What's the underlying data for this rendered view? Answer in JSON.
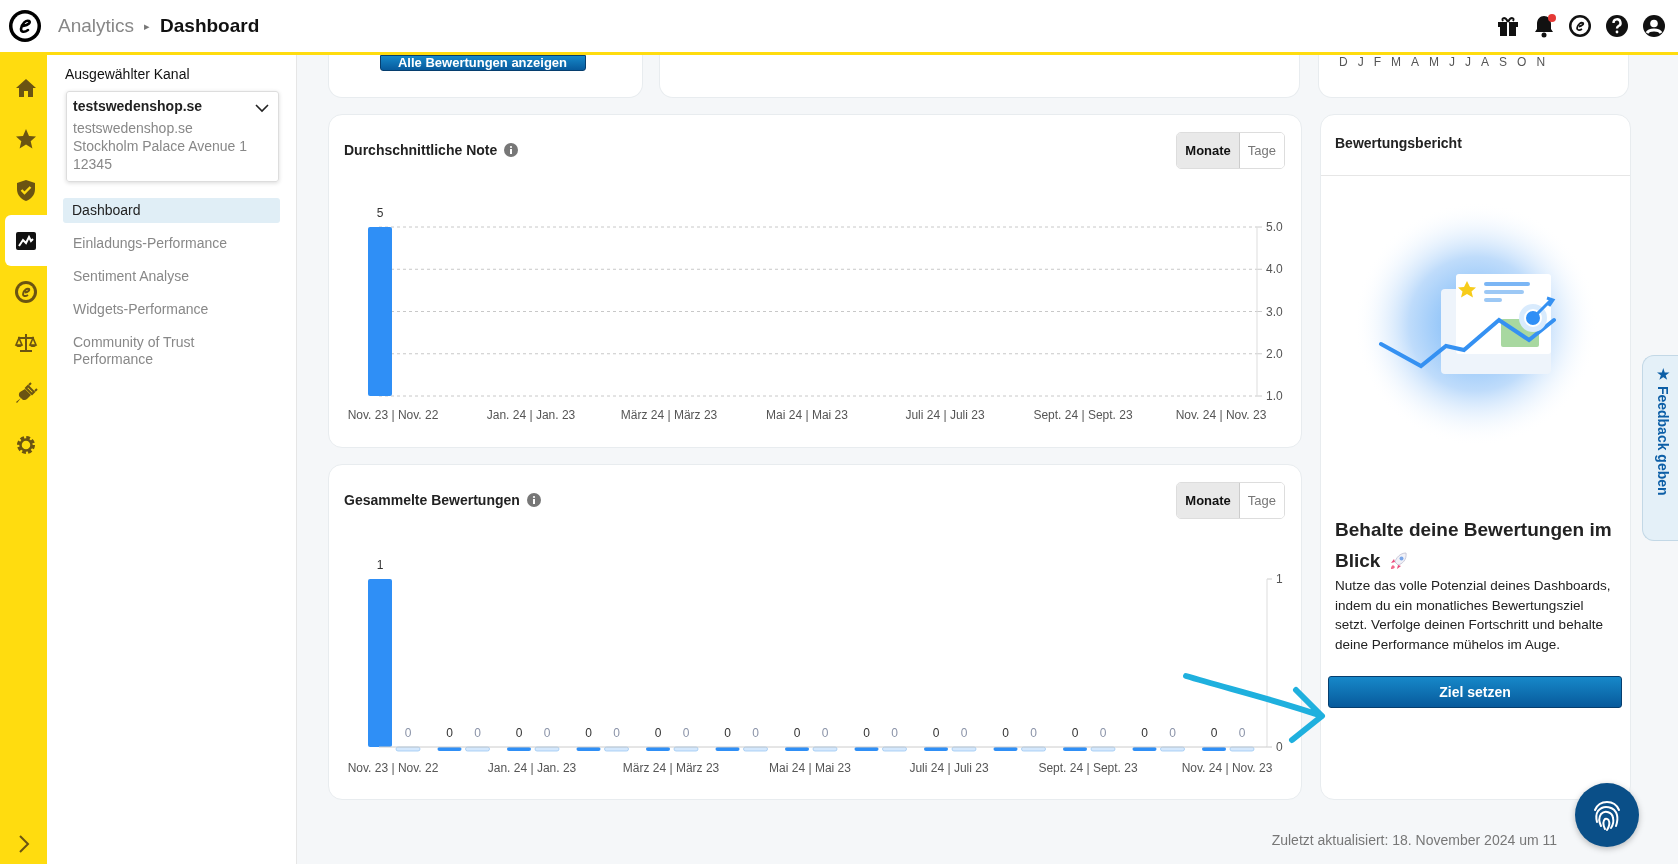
{
  "header": {
    "breadcrumb": [
      "Analytics",
      "Dashboard"
    ],
    "separator": "▸",
    "bell_notification": true
  },
  "rail": {
    "items": [
      {
        "selected": false
      },
      {
        "selected": false
      },
      {
        "selected": false
      },
      {
        "selected": true
      },
      {
        "selected": false
      },
      {
        "selected": false
      },
      {
        "selected": false
      },
      {
        "selected": false
      }
    ]
  },
  "sidebar": {
    "label": "Ausgewählter Kanal",
    "channel": {
      "name": "testswedenshop.se",
      "lines": [
        "testswedenshop.se",
        "Stockholm Palace Avenue 1",
        "12345"
      ]
    },
    "items": [
      {
        "label": "Dashboard",
        "selected": true
      },
      {
        "label": "Einladungs-Performance",
        "selected": false
      },
      {
        "label": "Sentiment Analyse",
        "selected": false
      },
      {
        "label": "Widgets-Performance",
        "selected": false
      },
      {
        "label": "Community of Trust Performance",
        "selected": false
      }
    ]
  },
  "top_cards": {
    "button": "Alle Bewertungen anzeigen",
    "month_letters": [
      "D",
      "J",
      "F",
      "M",
      "A",
      "M",
      "J",
      "J",
      "A",
      "S",
      "O",
      "N"
    ]
  },
  "charts": [
    {
      "title": "Durchschnittliche Note",
      "toggle": [
        {
          "label": "Monate",
          "selected": true
        },
        {
          "label": "Tage",
          "selected": false
        }
      ],
      "chart_data": {
        "type": "bar",
        "categories": [
          "Nov. 23 | Nov. 22",
          null,
          "Jan. 24 | Jan. 23",
          null,
          "März 24 | März 23",
          null,
          "Mai 24 | Mai 23",
          null,
          "Juli 24 | Juli 23",
          null,
          "Sept. 24 | Sept. 23",
          null,
          "Nov. 24 | Nov. 23"
        ],
        "series": [
          {
            "color": "#2f8ff6",
            "values": [
              5,
              null,
              null,
              null,
              null,
              null,
              null,
              null,
              null,
              null,
              null,
              null,
              null
            ]
          }
        ],
        "ylim": [
          1,
          5
        ],
        "yticks": [
          {
            "value": 1,
            "label": "1.0"
          },
          {
            "value": 2,
            "label": "2.0"
          },
          {
            "value": 3,
            "label": "3.0"
          },
          {
            "value": 4,
            "label": "4.0"
          },
          {
            "value": 5,
            "label": "5.0"
          }
        ],
        "grid": true,
        "data_labels": true
      }
    },
    {
      "title": "Gesammelte Bewertungen",
      "toggle": [
        {
          "label": "Monate",
          "selected": true
        },
        {
          "label": "Tage",
          "selected": false
        }
      ],
      "chart_data": {
        "type": "bar",
        "categories": [
          "Nov. 23 | Nov. 22",
          null,
          "Jan. 24 | Jan. 23",
          null,
          "März 24 | März 23",
          null,
          "Mai 24 | Mai 23",
          null,
          "Juli 24 | Juli 23",
          null,
          "Sept. 24 | Sept. 23",
          null,
          "Nov. 24 | Nov. 23"
        ],
        "series": [
          {
            "color": "#2f8ff6",
            "values": [
              1,
              0,
              0,
              0,
              0,
              0,
              0,
              0,
              0,
              0,
              0,
              0,
              0
            ]
          },
          {
            "color": "#d4e8fd",
            "values": [
              0,
              0,
              0,
              0,
              0,
              0,
              0,
              0,
              0,
              0,
              0,
              0,
              0
            ]
          }
        ],
        "ylim": [
          0,
          1
        ],
        "yticks": [
          {
            "value": 0,
            "label": "0"
          },
          {
            "value": 1,
            "label": "1"
          }
        ],
        "data_labels": true
      }
    }
  ],
  "report": {
    "title": "Bewertungsbericht",
    "heading_lines": [
      "Behalte deine Bewertungen im",
      "Blick"
    ],
    "text": "Nutze das volle Potenzial deines Dashboards, indem du ein monatliches Bewertungsziel setzt. Verfolge deinen Fortschritt und behalte deine Performance mühelos im Auge.",
    "button": "Ziel setzen"
  },
  "feedback": {
    "icon": "★",
    "label": "Feedback geben"
  },
  "footer": "Zuletzt aktualisiert: 18. November 2024 um 11"
}
